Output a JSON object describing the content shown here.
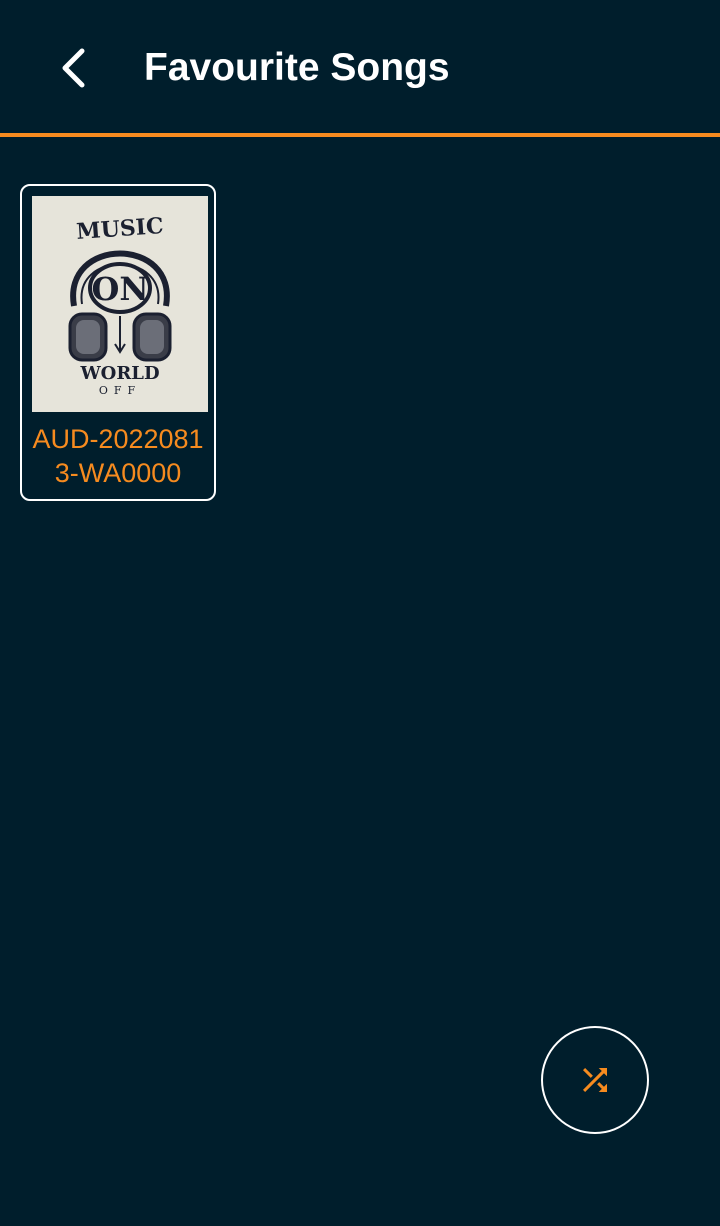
{
  "header": {
    "title": "Favourite Songs",
    "back_icon": "chevron-left-icon"
  },
  "songs": [
    {
      "name": "AUD-20220813-WA0000",
      "cover": {
        "top_text": "MUSIC",
        "center_text": "ON",
        "bottom_text": "WORLD",
        "bottom_sub_text": "OFF"
      }
    }
  ],
  "fab": {
    "icon": "shuffle-icon"
  },
  "colors": {
    "background": "#001e2c",
    "accent": "#f68b1f",
    "text": "#ffffff"
  }
}
